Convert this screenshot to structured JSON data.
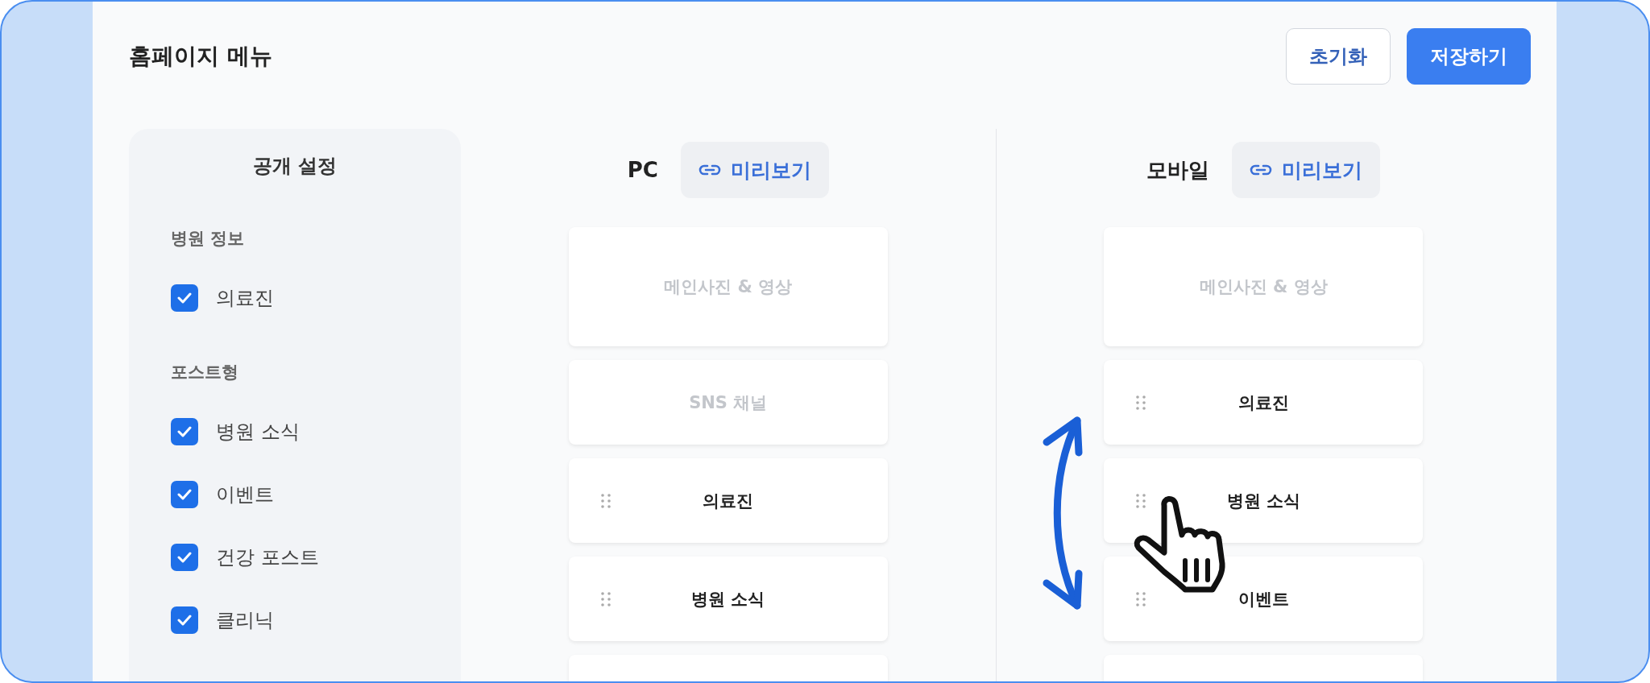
{
  "header": {
    "title": "홈페이지 메뉴",
    "buttons": [
      {
        "label": "초기화",
        "kind": "outline"
      },
      {
        "label": "저장하기",
        "kind": "primary"
      }
    ]
  },
  "visibility": {
    "title": "공개 설정",
    "groups": [
      {
        "label": "병원 정보",
        "items": [
          {
            "label": "의료진",
            "checked": true
          }
        ]
      },
      {
        "label": "포스트형",
        "items": [
          {
            "label": "병원 소식",
            "checked": true
          },
          {
            "label": "이벤트",
            "checked": true
          },
          {
            "label": "건강 포스트",
            "checked": true
          },
          {
            "label": "클리닉",
            "checked": true
          }
        ]
      }
    ]
  },
  "columns": [
    {
      "title": "PC",
      "preview": "미리보기",
      "cards": [
        {
          "kind": "fixed",
          "label": "메인사진 & 영상"
        },
        {
          "kind": "fixed",
          "label": "SNS 채널"
        },
        {
          "kind": "draggable",
          "label": "의료진"
        },
        {
          "kind": "draggable",
          "label": "병원 소식"
        },
        {
          "kind": "empty"
        }
      ]
    },
    {
      "title": "모바일",
      "preview": "미리보기",
      "cards": [
        {
          "kind": "fixed",
          "label": "메인사진 & 영상"
        },
        {
          "kind": "draggable",
          "label": "의료진"
        },
        {
          "kind": "draggable",
          "label": "병원 소식"
        },
        {
          "kind": "draggable",
          "label": "이벤트"
        },
        {
          "kind": "empty"
        }
      ]
    }
  ]
}
